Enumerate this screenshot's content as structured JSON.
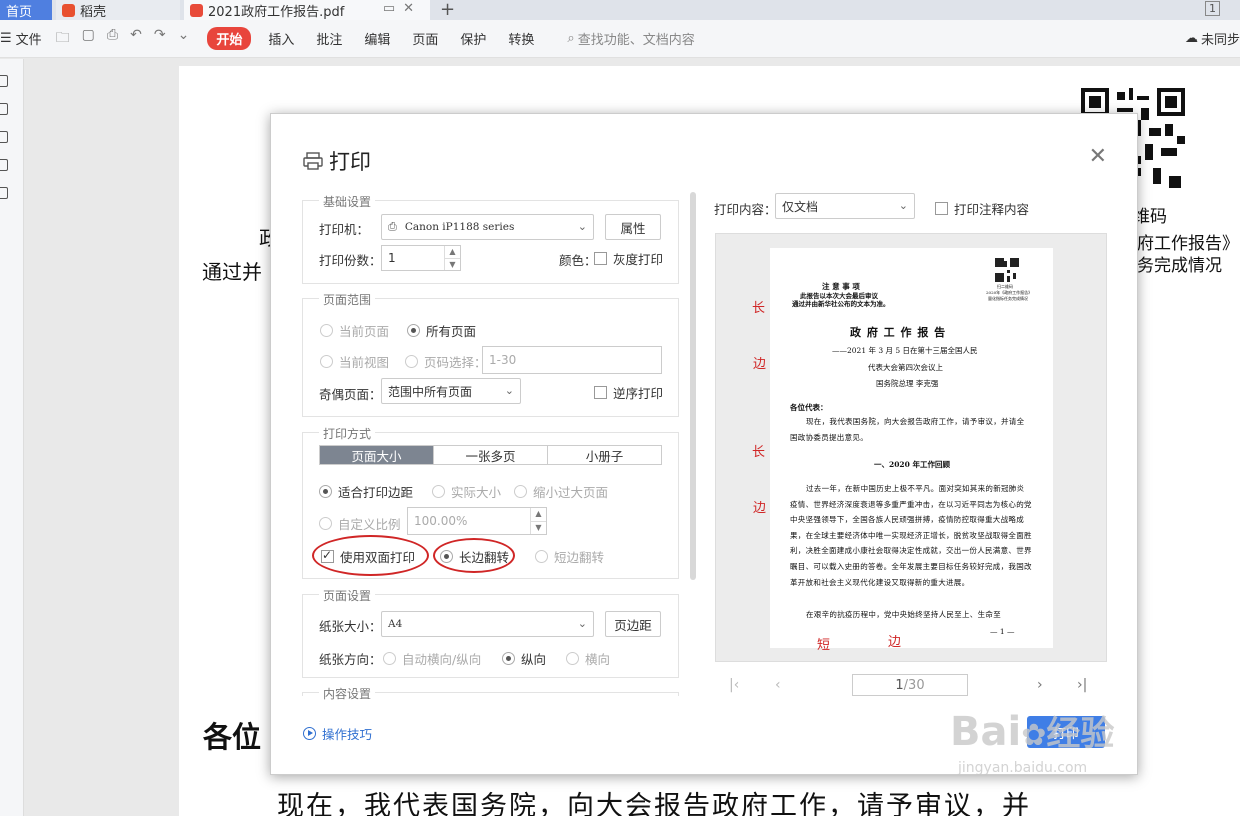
{
  "tabs": {
    "home": "首页",
    "daoke": "稻壳",
    "pdf": "2021政府工作报告.pdf",
    "page_count": "1"
  },
  "toolbar": {
    "file": "文件",
    "menus": [
      "开始",
      "插入",
      "批注",
      "编辑",
      "页面",
      "保护",
      "转换"
    ],
    "search_placeholder": "查找功能、文档内容",
    "sync": "未同步"
  },
  "document": {
    "right_lines": [
      "维码",
      "府工作报告》",
      "务完成情况"
    ],
    "left_line1": "政",
    "left_line2": "通过并",
    "greeting": "各位",
    "bottom": "现在，我代表国务院，向大会报告政府工作，请予审议，并"
  },
  "dialog": {
    "title": "打印",
    "basic": {
      "title": "基础设置",
      "printer_label": "打印机：",
      "printer_value": "Canon iP1188 series",
      "properties_btn": "属性",
      "copies_label": "打印份数：",
      "copies_value": "1",
      "color_label": "颜色：",
      "grayscale_label": "灰度打印"
    },
    "range": {
      "title": "页面范围",
      "current_page": "当前页面",
      "all_pages": "所有页面",
      "current_view": "当前视图",
      "page_select": "页码选择：",
      "page_select_value": "1-30",
      "odd_even_label": "奇偶页面：",
      "odd_even_value": "范围中所有页面",
      "reverse_label": "逆序打印"
    },
    "mode": {
      "title": "打印方式",
      "tabs": [
        "页面大小",
        "一张多页",
        "小册子"
      ],
      "fit_margin": "适合打印边距",
      "actual_size": "实际大小",
      "shrink": "缩小过大页面",
      "custom_scale": "自定义比例",
      "scale_value": "100.00%",
      "duplex": "使用双面打印",
      "long_edge": "长边翻转",
      "short_edge": "短边翻转"
    },
    "page_setup": {
      "title": "页面设置",
      "paper_size_label": "纸张大小：",
      "paper_size_value": "A4",
      "margin_btn": "页边距",
      "orientation_label": "纸张方向：",
      "auto": "自动横向/纵向",
      "portrait": "纵向",
      "landscape": "横向"
    },
    "content_setup_title": "内容设置",
    "print_content_label": "打印内容：",
    "print_content_value": "仅文档",
    "print_annot_label": "打印注释内容",
    "tips": "操作技巧",
    "print_btn": "打印",
    "pager": {
      "current": "1",
      "total": "/30"
    }
  },
  "preview": {
    "notice_title": "注 意 事 项",
    "notice_1": "此报告以本次大会最后审议",
    "notice_2": "通过并由新华社公布的文本为准。",
    "qr_caption_1": "扫二维码",
    "qr_caption_2": "2020年《政府工作报告》",
    "qr_caption_3": "量化指标任务完成情况",
    "heading": "政 府 工 作 报 告",
    "sub1": "——2021 年 3 月 5 日在第十三届全国人民",
    "sub2": "代表大会第四次会议上",
    "sub3": "国务院总理  李克强",
    "greet": "各位代表：",
    "para1": "现在，我代表国务院，向大会报告政府工作，请予审议，并请全国政协委员提出意见。",
    "section": "一、2020 年工作回顾",
    "para2": "过去一年，在新中国历史上极不平凡。面对突如其来的新冠肺炎疫情、世界经济深度衰退等多重严重冲击，在以习近平同志为核心的党中央坚强领导下，全国各族人民顽强拼搏，疫情防控取得重大战略成果，在全球主要经济体中唯一实现经济正增长，脱贫攻坚战取得全面胜利，决胜全面建成小康社会取得决定性成就，交出一份人民满意、世界瞩目、可以载入史册的答卷。全年发展主要目标任务较好完成，我国改革开放和社会主义现代化建设又取得新的重大进展。",
    "para3": "在艰辛的抗疫历程中，党中央始终坚持人民至上、生命至",
    "page_no": "— 1 —"
  },
  "annotations": {
    "long": "长",
    "edge": "边",
    "short": "短"
  },
  "watermark": {
    "brand": "Bai",
    "jingyan": "经验",
    "url": "jingyan.baidu.com"
  },
  "colors": {
    "accent_red": "#e8453c",
    "tab_blue": "#4f7fe0",
    "print_blue": "#3f7ee6",
    "annotation_red": "#d02626"
  }
}
